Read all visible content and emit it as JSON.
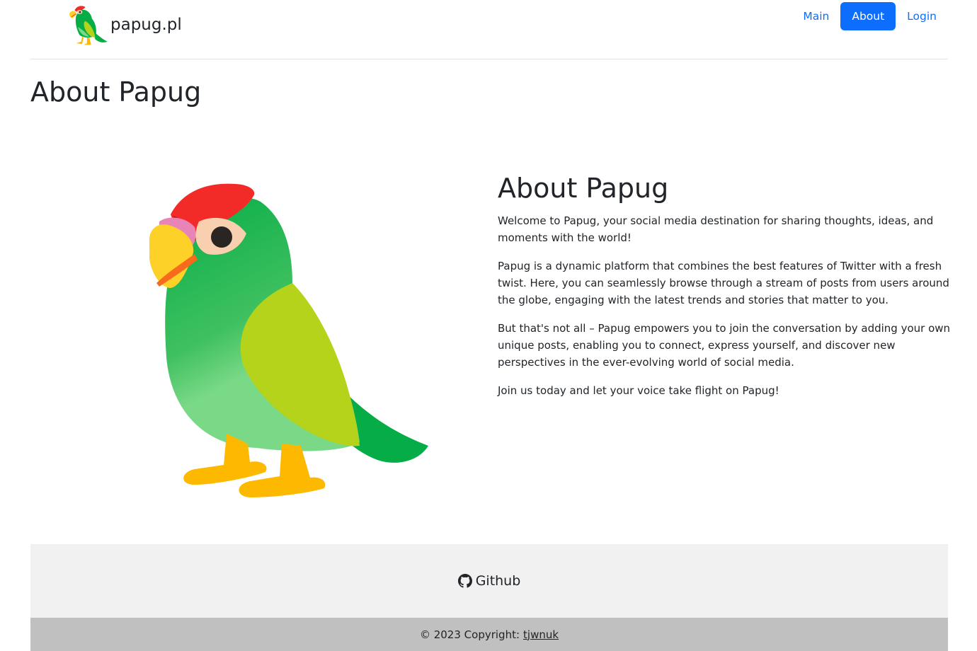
{
  "header": {
    "brand_name": "papug.pl",
    "nav": [
      {
        "label": "Main",
        "active": false
      },
      {
        "label": "About",
        "active": true
      },
      {
        "label": "Login",
        "active": false
      }
    ]
  },
  "page": {
    "title": "About Papug"
  },
  "about": {
    "heading": "About Papug",
    "paragraphs": [
      "Welcome to Papug, your social media destination for sharing thoughts, ideas, and moments with the world!",
      "Papug is a dynamic platform that combines the best features of Twitter with a fresh twist. Here, you can seamlessly browse through a stream of posts from users around the globe, engaging with the latest trends and stories that matter to you.",
      "But that's not all – Papug empowers you to join the conversation by adding your own unique posts, enabling you to connect, express yourself, and discover new perspectives in the ever-evolving world of social media.",
      "Join us today and let your voice take flight on Papug!"
    ]
  },
  "footer": {
    "github_label": "Github",
    "copyright_prefix": "© 2023 Copyright:",
    "copyright_link": "tjwnuk"
  },
  "colors": {
    "accent": "#0d6efd",
    "footer_top_bg": "#f1f1f1",
    "footer_bottom_bg": "#c0c0c0"
  },
  "icons": {
    "brand_logo": "parrot-icon",
    "hero": "parrot-illustration",
    "github": "github-icon"
  }
}
